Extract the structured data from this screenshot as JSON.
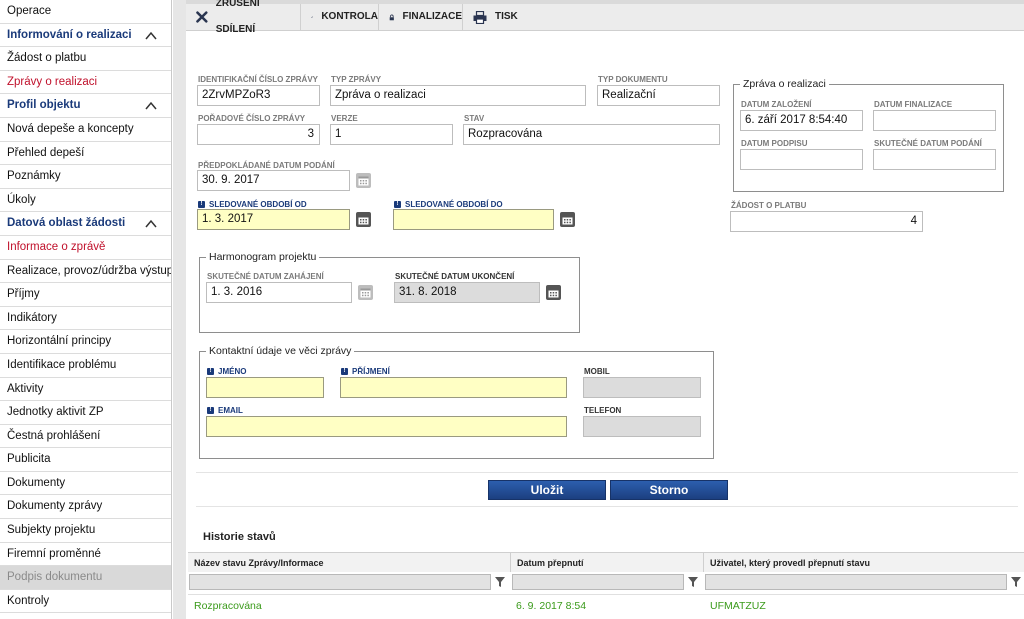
{
  "sidebar": {
    "items": [
      {
        "label": "Operace",
        "type": "item"
      },
      {
        "label": "Informování o realizaci",
        "type": "section"
      },
      {
        "label": "Žádost o platbu",
        "type": "item"
      },
      {
        "label": "Zprávy o realizaci",
        "type": "active"
      },
      {
        "label": "Profil objektu",
        "type": "section"
      },
      {
        "label": "Nová depeše a koncepty",
        "type": "item"
      },
      {
        "label": "Přehled depeší",
        "type": "item"
      },
      {
        "label": "Poznámky",
        "type": "item"
      },
      {
        "label": "Úkoly",
        "type": "item"
      },
      {
        "label": "Datová oblast žádosti",
        "type": "section"
      },
      {
        "label": "Informace o zprávě",
        "type": "active"
      },
      {
        "label": "Realizace, provoz/údržba výstupu",
        "type": "item"
      },
      {
        "label": "Příjmy",
        "type": "item"
      },
      {
        "label": "Indikátory",
        "type": "item"
      },
      {
        "label": "Horizontální principy",
        "type": "item"
      },
      {
        "label": "Identifikace problému",
        "type": "item"
      },
      {
        "label": "Aktivity",
        "type": "item"
      },
      {
        "label": "Jednotky aktivit ZP",
        "type": "item"
      },
      {
        "label": "Čestná prohlášení",
        "type": "item"
      },
      {
        "label": "Publicita",
        "type": "item"
      },
      {
        "label": "Dokumenty",
        "type": "item"
      },
      {
        "label": "Dokumenty zprávy",
        "type": "item"
      },
      {
        "label": "Subjekty projektu",
        "type": "item"
      },
      {
        "label": "Firemní proměnné",
        "type": "item"
      },
      {
        "label": "Podpis dokumentu",
        "type": "disabled"
      },
      {
        "label": "Kontroly",
        "type": "item"
      }
    ]
  },
  "toolbar": {
    "cancel_sharing": "ZRUŠENÍ SDÍLENÍ",
    "check": "KONTROLA",
    "finalize": "FINALIZACE",
    "print": "TISK"
  },
  "form": {
    "report_id_label": "IDENTIFIKAČNÍ ČÍSLO ZPRÁVY",
    "report_id": "2ZrvMPZoR3",
    "report_type_label": "TYP ZPRÁVY",
    "report_type": "Zpráva o realizaci",
    "doc_type_label": "TYP DOKUMENTU",
    "doc_type": "Realizační",
    "order_label": "POŘADOVÉ ČÍSLO ZPRÁVY",
    "order": "3",
    "version_label": "VERZE",
    "version": "1",
    "state_label": "STAV",
    "state": "Rozpracována",
    "expected_date_label": "PŘEDPOKLÁDANÉ DATUM PODÁNÍ",
    "expected_date": "30. 9. 2017",
    "period_from_label": "SLEDOVANÉ OBDOBÍ OD",
    "period_from": "1. 3. 2017",
    "period_to_label": "SLEDOVANÉ OBDOBÍ DO",
    "period_to": ""
  },
  "report_box": {
    "title": "Zpráva o realizaci",
    "created_label": "DATUM ZALOŽENÍ",
    "created": "6. září 2017 8:54:40",
    "finalized_label": "DATUM FINALIZACE",
    "finalized": "",
    "signed_label": "DATUM PODPISU",
    "signed": "",
    "submitted_label": "SKUTEČNÉ DATUM PODÁNÍ",
    "submitted": ""
  },
  "payment": {
    "label": "ŽÁDOST O PLATBU",
    "value": "4"
  },
  "schedule": {
    "title": "Harmonogram projektu",
    "start_label": "SKUTEČNÉ DATUM ZAHÁJENÍ",
    "start": "1. 3. 2016",
    "end_label": "SKUTEČNÉ DATUM UKONČENÍ",
    "end": "31. 8. 2018"
  },
  "contact": {
    "title": "Kontaktní údaje ve věci zprávy",
    "first_name_label": "JMÉNO",
    "last_name_label": "PŘÍJMENÍ",
    "mobile_label": "MOBIL",
    "email_label": "EMAIL",
    "phone_label": "TELEFON"
  },
  "actions": {
    "save": "Uložit",
    "cancel": "Storno"
  },
  "history": {
    "title": "Historie stavů",
    "columns": [
      "Název stavu Zprávy/Informace",
      "Datum přepnutí",
      "Uživatel, který provedl přepnutí stavu"
    ],
    "rows": [
      [
        "Rozpracována",
        "6. 9. 2017 8:54",
        "UFMATZUZ"
      ]
    ]
  },
  "colors": {
    "accent": "#1a3a7a",
    "active_link": "#c0102b",
    "required_fill": "#ffffc4",
    "history_text": "#3a9a1a"
  }
}
